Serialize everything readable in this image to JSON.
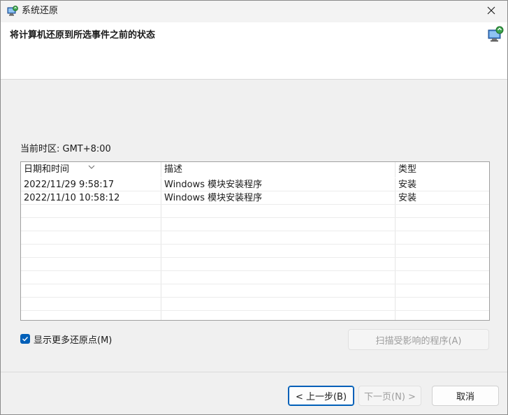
{
  "window": {
    "title": "系统还原",
    "header_title": "将计算机还原到所选事件之前的状态"
  },
  "timezone": "当前时区: GMT+8:00",
  "table": {
    "columns": [
      "日期和时间",
      "描述",
      "类型"
    ],
    "rows": [
      {
        "date": "2022/11/29 9:58:17",
        "description": "Windows 模块安装程序",
        "type": "安装"
      },
      {
        "date": "2022/11/10 10:58:12",
        "description": "Windows 模块安装程序",
        "type": "安装"
      }
    ]
  },
  "show_more": {
    "label": "显示更多还原点(M)",
    "checked": true
  },
  "buttons": {
    "scan": "扫描受影响的程序(A)",
    "back": "< 上一步(B)",
    "next": "下一页(N) >",
    "cancel": "取消"
  },
  "colors": {
    "accent": "#005fb8",
    "disabled_text": "#9d9d9d"
  },
  "icons": {
    "title": "system-restore-icon",
    "header": "system-restore-icon",
    "close": "close-icon",
    "sort": "chevron-down-icon",
    "checkbox": "checkmark-icon"
  }
}
